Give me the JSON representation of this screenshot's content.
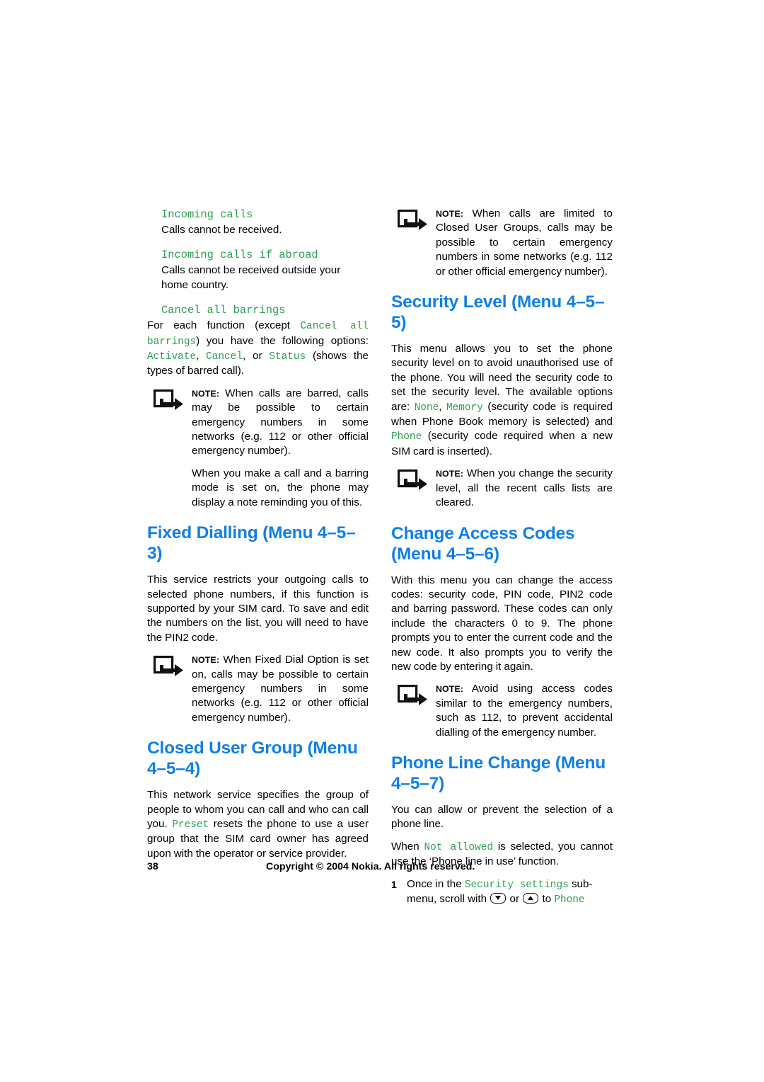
{
  "document": {
    "page_number": "38",
    "copyright": "Copyright © 2004 Nokia. All rights reserved.",
    "note_label": "NOTE:",
    "accent_blue": "#0f7fe8",
    "accent_green": "#2d9e4f"
  },
  "left_column": {
    "sub1_title": "Incoming calls",
    "sub1_body": "Calls cannot be received.",
    "sub2_title": "Incoming calls if abroad",
    "sub2_body": "Calls cannot be received outside your home country.",
    "sub3_title": "Cancel all barrings",
    "para_options": {
      "t1": "For each function (except ",
      "m1": "Cancel all barrings",
      "t2": ") you have the following options: ",
      "m2": "Activate",
      "t3": ", ",
      "m3": "Cancel",
      "t4": ", or ",
      "m4": "Status",
      "t5": " (shows the types of barred call)."
    },
    "note1_p1": "When calls are barred, calls may be possible to certain emergency numbers in some networks (e.g. 112 or other official emergency number).",
    "note1_p2": "When you make a call and a barring mode is set on, the phone may display a note reminding you of this.",
    "heading_fixed_dialling": "Fixed Dialling (Menu 4–5–3)",
    "fixed_dialling_body": "This service restricts your outgoing calls to selected phone numbers, if this function is supported by your SIM card. To save and edit the numbers on the list, you will need to have the PIN2 code.",
    "note2": "When Fixed Dial Option is set on, calls may be possible to certain emergency numbers in some networks (e.g. 112 or other official emergency number).",
    "heading_closed_user_group": "Closed User Group (Menu 4–5–4)",
    "closed_user_group": {
      "t1": "This network service specifies the group of people to whom you can call and who can call you. ",
      "m1": "Preset",
      "t2": " resets the phone to use a user group that the SIM card owner has agreed upon with the operator or service provider."
    }
  },
  "right_column": {
    "note3": "When calls are limited to Closed User Groups, calls may be possible to certain emergency numbers in some networks (e.g. 112 or other official emergency number).",
    "heading_security_level": "Security Level (Menu 4–5–5)",
    "security_level": {
      "t1": "This menu allows you to set the phone security level on to avoid unauthorised use of the phone. You will need the security code to set the security level. The available options are: ",
      "m1": "None",
      "t2": ", ",
      "m2": "Memory",
      "t3": " (security code is required when Phone Book memory is selected) and ",
      "m3": "Phone",
      "t4": " (security code required when a new SIM card is inserted)."
    },
    "note4": "When you change the security level, all the recent calls lists are cleared.",
    "heading_change_access_codes": "Change Access Codes (Menu 4–5–6)",
    "change_access_codes_body": "With this menu you can change the access codes: security code, PIN code, PIN2 code and barring password. These codes can only include the characters 0 to 9. The phone prompts you to enter the current code and the new code. It also prompts you to verify the new code by entering it again.",
    "note5": "Avoid using access codes similar to the emergency numbers, such as 112, to prevent accidental dialling of the emergency number.",
    "heading_phone_line_change": "Phone Line Change (Menu 4–5–7)",
    "phone_line_body": "You can allow or prevent the selection of a phone line.",
    "not_allowed_para": {
      "t1": "When ",
      "m1": "Not allowed",
      "t2": " is selected, you cannot use the ‘Phone line in use’ function."
    },
    "step1": {
      "num": "1",
      "t1": "Once in the ",
      "m1": "Security settings",
      "t2": " sub-menu, scroll with ",
      "key_down": "scroll-down-key",
      "t3": " or ",
      "key_up": "scroll-up-key",
      "t4": " to ",
      "m2": "Phone"
    }
  }
}
